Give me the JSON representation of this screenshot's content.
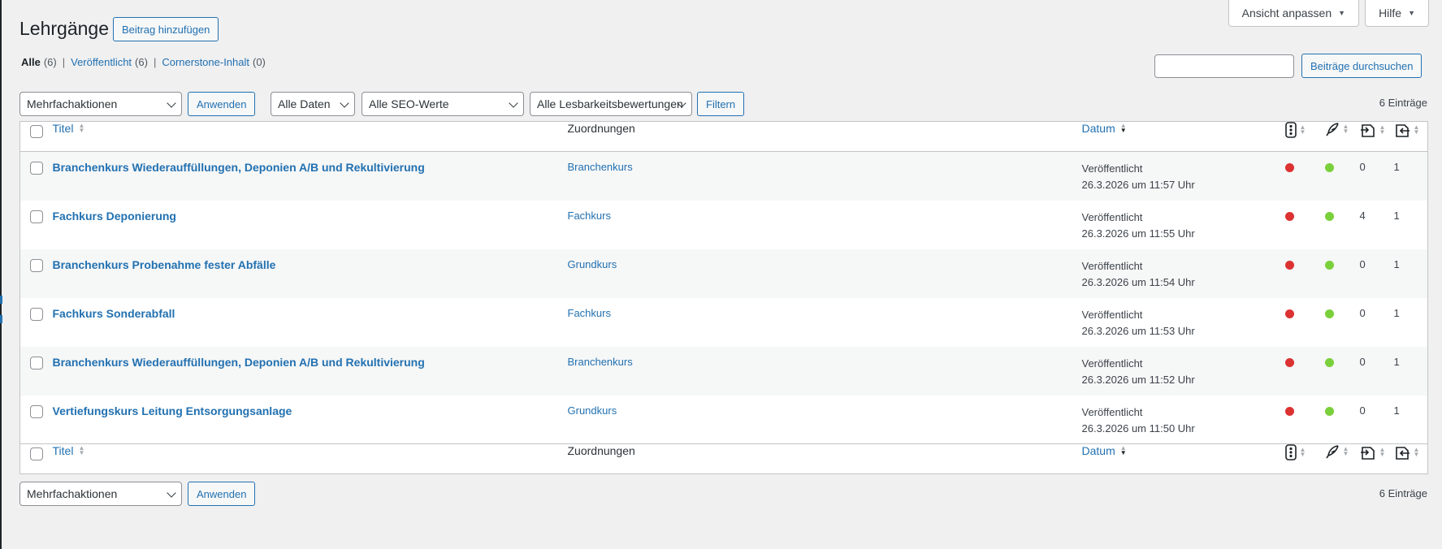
{
  "screen_options": {
    "view_label": "Ansicht anpassen",
    "help_label": "Hilfe"
  },
  "page": {
    "title": "Lehrgänge",
    "add_new_label": "Beitrag hinzufügen"
  },
  "views": [
    {
      "label": "Alle",
      "count": "(6)",
      "current": true
    },
    {
      "label": "Veröffentlicht",
      "count": "(6)"
    },
    {
      "label": "Cornerstone-Inhalt",
      "count": "(0)"
    }
  ],
  "search": {
    "value": "",
    "button_label": "Beiträge durchsuchen"
  },
  "top_nav": {
    "bulk_action_selected": "Mehrfachaktionen",
    "apply_label": "Anwenden",
    "date_filter_selected": "Alle Daten",
    "seo_filter_selected": "Alle SEO-Werte",
    "readability_filter_selected": "Alle Lesbarkeitsbewertungen",
    "filter_label": "Filtern",
    "items_count": "6 Einträge"
  },
  "bottom_nav": {
    "bulk_action_selected": "Mehrfachaktionen",
    "apply_label": "Anwenden",
    "items_count": "6 Einträge"
  },
  "columns": {
    "title": "Titel",
    "taxonomy": "Zuordnungen",
    "date": "Datum",
    "seo_icon": "traffic-light-icon",
    "readability_icon": "feather-icon",
    "outgoing_links_icon": "outgoing-links-icon",
    "incoming_links_icon": "incoming-links-icon"
  },
  "status_colors": {
    "seo": "#dc3232",
    "readability": "#7ad03a"
  },
  "rows": [
    {
      "title": "Branchenkurs Wiederauffüllungen, Deponien A/B und Rekultivierung",
      "taxonomy": "Branchenkurs",
      "status": "Veröffentlicht",
      "date": "26.3.2026 um 11:57 Uhr",
      "seo": "bad",
      "readability": "good",
      "outgoing": "0",
      "incoming": "1"
    },
    {
      "title": "Fachkurs Deponierung",
      "taxonomy": "Fachkurs",
      "status": "Veröffentlicht",
      "date": "26.3.2026 um 11:55 Uhr",
      "seo": "bad",
      "readability": "good",
      "outgoing": "4",
      "incoming": "1"
    },
    {
      "title": "Branchenkurs Probenahme fester Abfälle",
      "taxonomy": "Grundkurs",
      "status": "Veröffentlicht",
      "date": "26.3.2026 um 11:54 Uhr",
      "seo": "bad",
      "readability": "good",
      "outgoing": "0",
      "incoming": "1"
    },
    {
      "title": "Fachkurs Sonderabfall",
      "taxonomy": "Fachkurs",
      "status": "Veröffentlicht",
      "date": "26.3.2026 um 11:53 Uhr",
      "seo": "bad",
      "readability": "good",
      "outgoing": "0",
      "incoming": "1"
    },
    {
      "title": "Branchenkurs Wiederauffüllungen, Deponien A/B und Rekultivierung",
      "taxonomy": "Branchenkurs",
      "status": "Veröffentlicht",
      "date": "26.3.2026 um 11:52 Uhr",
      "seo": "bad",
      "readability": "good",
      "outgoing": "0",
      "incoming": "1"
    },
    {
      "title": "Vertiefungskurs Leitung Entsorgungsanlage",
      "taxonomy": "Grundkurs",
      "status": "Veröffentlicht",
      "date": "26.3.2026 um 11:50 Uhr",
      "seo": "bad",
      "readability": "good",
      "outgoing": "0",
      "incoming": "1"
    }
  ]
}
